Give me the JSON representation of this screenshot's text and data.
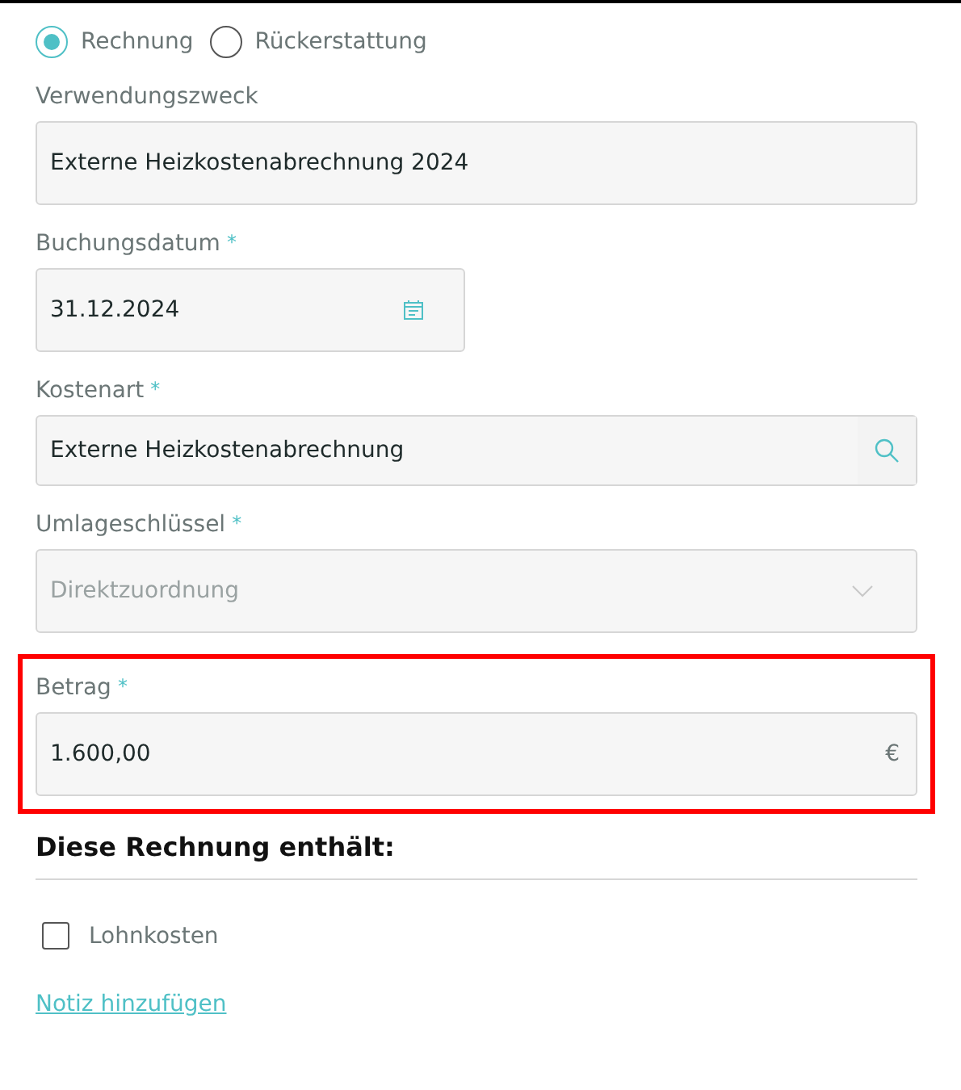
{
  "invoice_type": [
    {
      "label": "Rechnung",
      "selected": true
    },
    {
      "label": "Rückerstattung",
      "selected": false
    }
  ],
  "fields": [
    {
      "kind": "text",
      "label": "Verwendungszweck",
      "value": "Externe Heizkostenabrechnung 2024",
      "disabled": false,
      "highlighted": false
    },
    {
      "kind": "date",
      "label": "Buchungsdatum",
      "required_mark": "*",
      "value": "31.12.2024",
      "disabled": false,
      "highlighted": false
    },
    {
      "kind": "search",
      "label": "Kostenart",
      "required_mark": "*",
      "value": "Externe Heizkostenabrechnung",
      "disabled": false,
      "highlighted": false
    },
    {
      "kind": "select",
      "label": "Umlageschlüssel",
      "required_mark": "*",
      "value": "Direktzuordnung",
      "disabled": true,
      "highlighted": false
    },
    {
      "kind": "amount",
      "label": "Betrag",
      "required_mark": "*",
      "value": "1.600,00",
      "suffix": "€",
      "disabled": false,
      "highlighted": true
    }
  ],
  "section_title": "Diese Rechnung enthält:",
  "checkboxes": [
    {
      "label": "Lohnkosten",
      "checked": false
    }
  ],
  "add_note_link": "Notiz hinzufügen"
}
